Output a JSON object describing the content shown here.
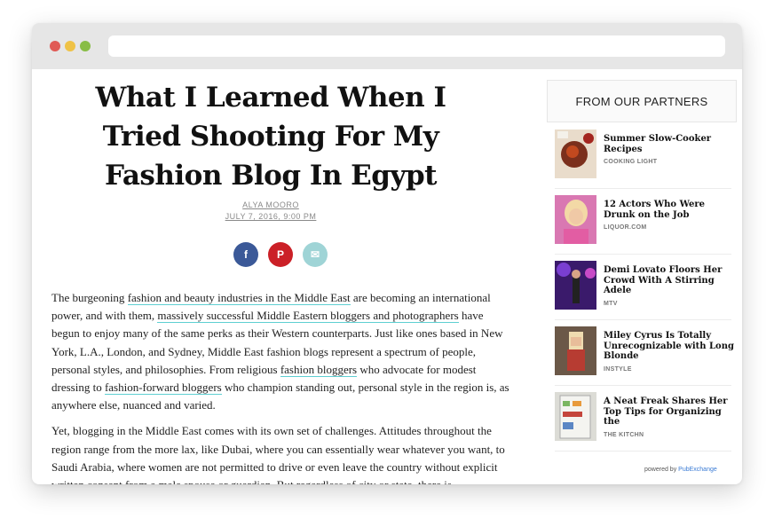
{
  "article": {
    "title": "What I Learned When I Tried Shooting For My Fashion Blog In Egypt",
    "author": "ALYA MOORO",
    "date": "JULY 7, 2016, 9:00 PM",
    "share": [
      {
        "icon": "facebook-icon",
        "glyph": "f",
        "color": "#3b5998"
      },
      {
        "icon": "pinterest-icon",
        "glyph": "P",
        "color": "#cb2027"
      },
      {
        "icon": "email-icon",
        "glyph": "✉",
        "color": "#9fd4d6"
      }
    ],
    "paragraph1": {
      "t1": "The burgeoning ",
      "l1": "fashion and beauty industries in the Middle East",
      "t2": " are becoming an international power, and with them, ",
      "l2": "massively successful Middle Eastern bloggers and photographers",
      "t3": " have begun to enjoy many of the same perks as their Western counterparts. Just like ones based in New York, L.A., London, and Sydney, Middle East fashion blogs represent a spectrum of people, personal styles, and philosophies. From religious ",
      "l3": "fashion bloggers",
      "t4": " who advocate for modest dressing to ",
      "l4": "fashion-forward bloggers",
      "t5": " who champion standing out, personal style in the region is, as anywhere else, nuanced and varied."
    },
    "paragraph2": "Yet, blogging in the Middle East comes with its own set of challenges. Attitudes throughout the region range from the more lax, like Dubai, where you can essentially wear whatever you want, to Saudi Arabia, where women are not permitted to drive or even leave the country without explicit written consent from a male spouse or guardian. But regardless of city or state, there is"
  },
  "sidebar": {
    "heading": "FROM OUR PARTNERS",
    "items": [
      {
        "title": "Summer Slow-Cooker Recipes",
        "source": "COOKING LIGHT"
      },
      {
        "title": "12 Actors Who Were Drunk on the Job",
        "source": "LIQUOR.COM"
      },
      {
        "title": "Demi Lovato Floors Her Crowd With A Stirring Adele",
        "source": "MTV"
      },
      {
        "title": "Miley Cyrus Is Totally Unrecognizable with Long Blonde",
        "source": "INSTYLE"
      },
      {
        "title": "A Neat Freak Shares Her Top Tips for Organizing the",
        "source": "THE KITCHN"
      }
    ],
    "powered_by": "powered by",
    "powered_brand": "PubExchange"
  },
  "colors": {
    "link_underline": "#5ecfd2",
    "chrome": "#e6e6e6"
  }
}
